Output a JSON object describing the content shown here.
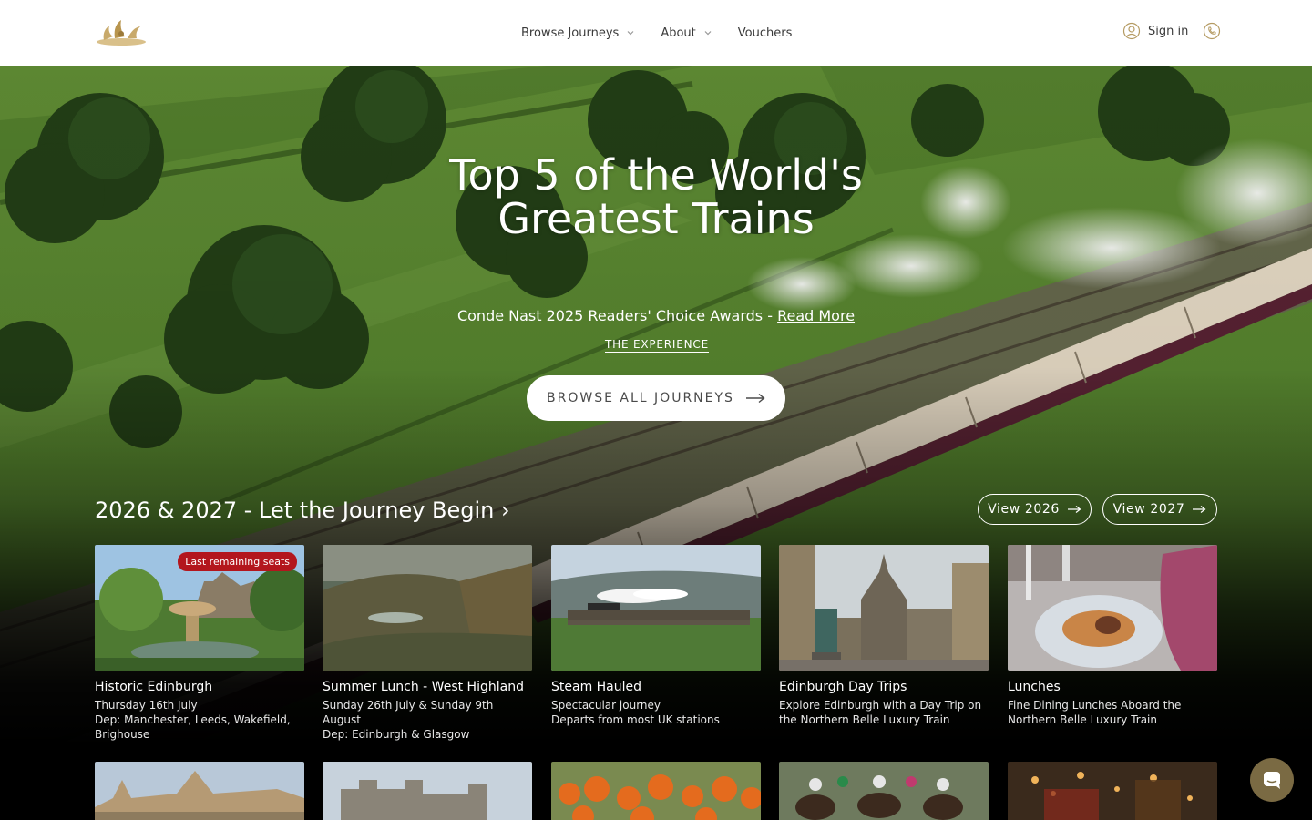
{
  "header": {
    "logo_alt": "Northern Belle",
    "nav": [
      {
        "label": "Browse Journeys",
        "has_dropdown": true
      },
      {
        "label": "About",
        "has_dropdown": true
      },
      {
        "label": "Vouchers",
        "has_dropdown": false
      }
    ],
    "sign_in": "Sign in"
  },
  "hero": {
    "title": "Top 5 of the World's Greatest Trains",
    "subtitle_prefix": "Conde Nast 2025 Readers' Choice Awards - ",
    "subtitle_link": "Read More",
    "experience_link": "THE EXPERIENCE",
    "browse_button": "BROWSE ALL JOURNEYS"
  },
  "journeys": {
    "heading": "2026 & 2027 - Let the Journey Begin ›",
    "view_2026": "View 2026",
    "view_2027": "View 2027",
    "cards": [
      {
        "badge": "Last remaining seats",
        "title": "Historic Edinburgh",
        "lines": [
          "Thursday 16th July",
          "Dep: Manchester, Leeds, Wakefield,",
          "Brighouse"
        ]
      },
      {
        "badge": "",
        "title": "Summer Lunch - West Highland",
        "lines": [
          "Sunday 26th July & Sunday 9th",
          "August",
          "Dep: Edinburgh & Glasgow"
        ]
      },
      {
        "badge": "",
        "title": "Steam Hauled",
        "lines": [
          "Spectacular journey",
          "Departs from most UK stations"
        ]
      },
      {
        "badge": "",
        "title": "Edinburgh Day Trips",
        "lines": [
          "Explore Edinburgh with a Day Trip on",
          "the Northern Belle Luxury Train"
        ]
      },
      {
        "badge": "",
        "title": "Lunches",
        "lines": [
          "Fine Dining Lunches Aboard the",
          "Northern Belle Luxury Train"
        ]
      }
    ]
  },
  "colors": {
    "badge": "#b3161d",
    "chat_button": "#7a6a43",
    "logo_gold": "#c8a96a"
  },
  "icons": {
    "nav_dropdown": "chevron-down-icon",
    "sign_in": "user-circle-icon",
    "phone": "phone-icon",
    "arrow": "arrow-right-icon",
    "chat": "chat-icon"
  }
}
